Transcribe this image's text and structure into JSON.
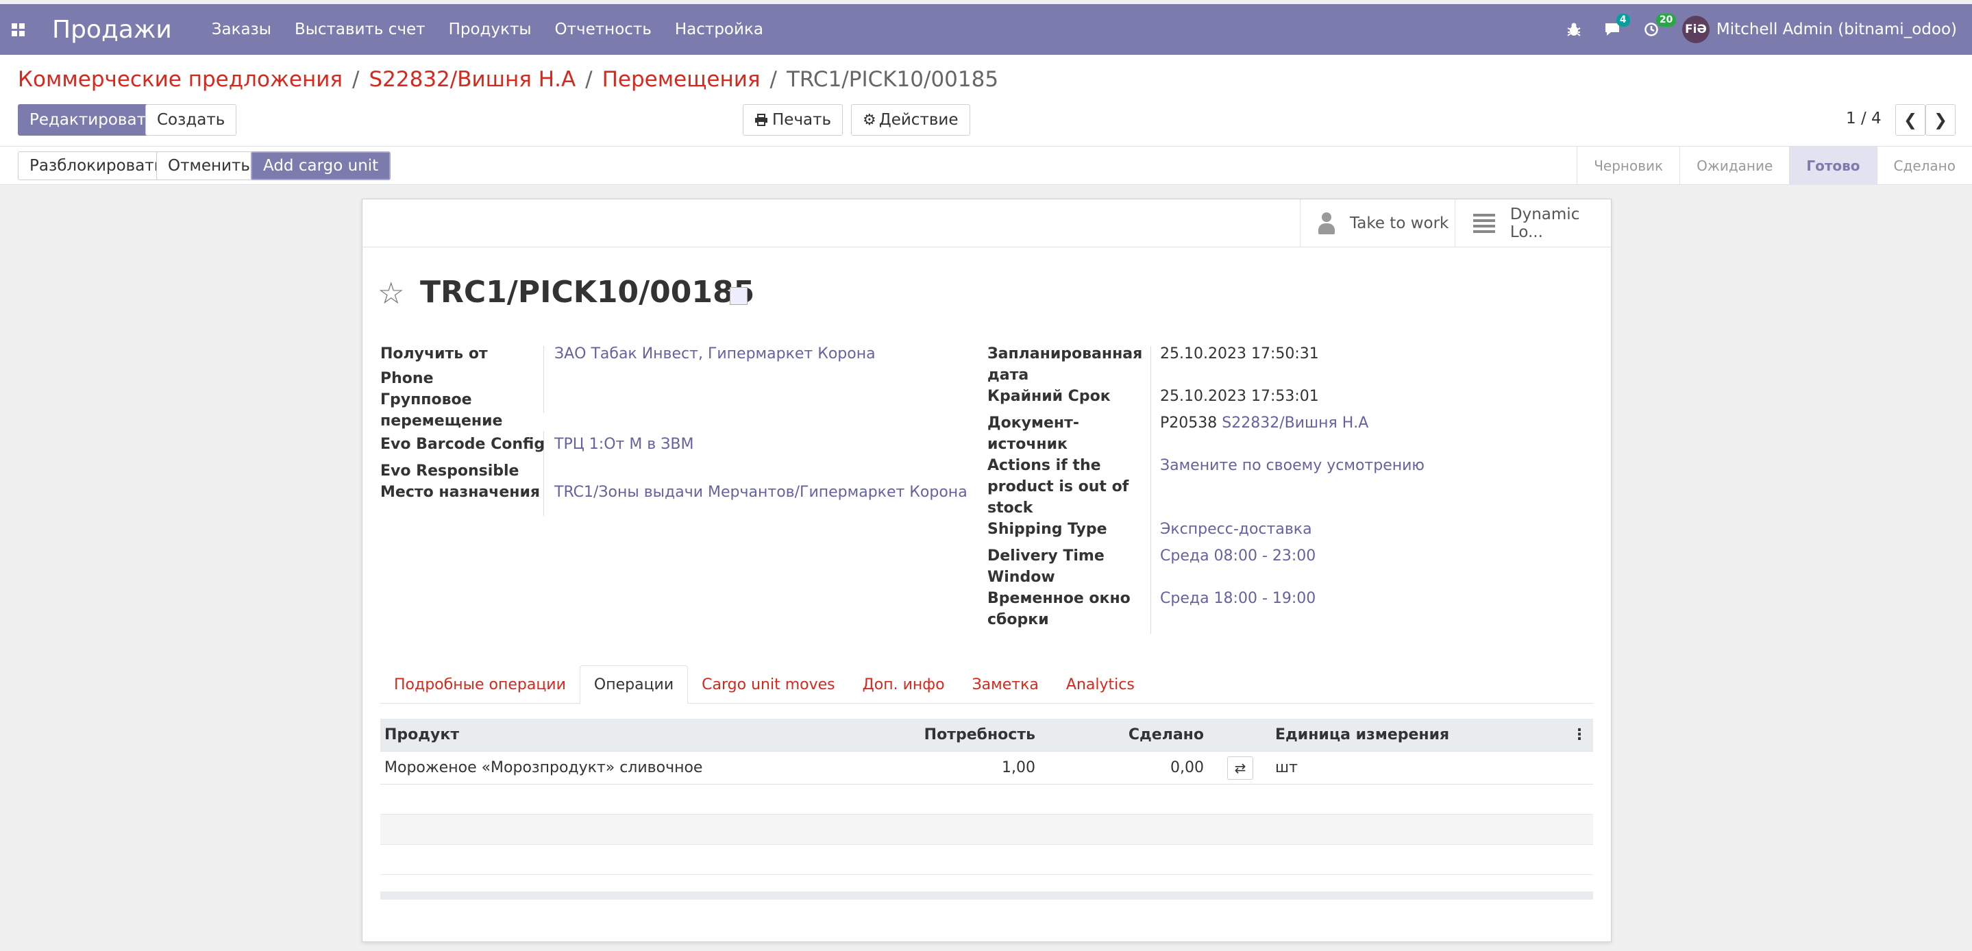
{
  "navbar": {
    "brand": "Продажи",
    "menu": [
      "Заказы",
      "Выставить счет",
      "Продукты",
      "Отчетность",
      "Настройка"
    ],
    "messages_count": "4",
    "activities_count": "20",
    "user_initials": "FiƏ",
    "user_name": "Mitchell Admin (bitnami_odoo)"
  },
  "breadcrumb": {
    "items": [
      "Коммерческие предложения",
      "S22832/Вишня Н.А",
      "Перемещения"
    ],
    "current": "TRC1/PICK10/00185",
    "sep": "/"
  },
  "toolbar": {
    "edit_label": "Редактировать",
    "create_label": "Создать",
    "print_label": "Печать",
    "action_label": "Действие",
    "pager": "1 / 4"
  },
  "statusbar": {
    "unlock_label": "Разблокировать",
    "cancel_label": "Отменить",
    "cargo_label": "Add cargo unit",
    "stages": [
      "Черновик",
      "Ожидание",
      "Готово",
      "Сделано"
    ],
    "active_stage": "Готово"
  },
  "smart_buttons": {
    "take_to_work": "Take to work",
    "dynamic": "Dynamic Lo..."
  },
  "record": {
    "title": "TRC1/PICK10/00185"
  },
  "left_fields": {
    "partner_label": "Получить от",
    "partner_value": "ЗАО Табак Инвест, Гипермаркет Корона",
    "phone_label": "Phone",
    "group_label_1": "Групповое",
    "group_label_2": "перемещение",
    "evo_config_label": "Evo Barcode Config",
    "evo_config_value": "ТРЦ 1:От М в ЗВМ",
    "evo_resp_label": "Evo Responsible",
    "dest_label": "Место назначения",
    "dest_value": "TRC1/Зоны выдачи Мерчантов/Гипермаркет Корона"
  },
  "right_fields": {
    "scheduled_label_1": "Запланированная",
    "scheduled_label_2": "дата",
    "scheduled_value": "25.10.2023 17:50:31",
    "deadline_label": "Крайний Срок",
    "deadline_value": "25.10.2023 17:53:01",
    "origin_label_1": "Документ-",
    "origin_label_2": "источник",
    "origin_value_plain": "P20538",
    "origin_value_link": "S22832/Вишня Н.А",
    "actions_label_1": "Actions if the",
    "actions_label_2": "product is out of",
    "actions_label_3": "stock",
    "actions_value": "Замените по своему усмотрению",
    "shipping_label": "Shipping Type",
    "shipping_value": "Экспресс-доставка",
    "delivery_label_1": "Delivery Time",
    "delivery_label_2": "Window",
    "delivery_value": "Среда 08:00 - 23:00",
    "assembly_label_1": "Временное окно",
    "assembly_label_2": "сборки",
    "assembly_value": "Среда 18:00 - 19:00"
  },
  "tabs": [
    "Подробные операции",
    "Операции",
    "Cargo unit moves",
    "Доп. инфо",
    "Заметка",
    "Analytics"
  ],
  "active_tab": "Операции",
  "table": {
    "headers": {
      "product": "Продукт",
      "need": "Потребность",
      "done": "Сделано",
      "uom": "Единица измерения"
    },
    "rows": [
      {
        "product": "Мороженое «Морозпродукт» сливочное",
        "need": "1,00",
        "done": "0,00",
        "uom": "шт"
      }
    ]
  },
  "colors": {
    "brand": "#7c7bad",
    "link_red": "#d6281d",
    "link_purple": "#6463a0"
  }
}
